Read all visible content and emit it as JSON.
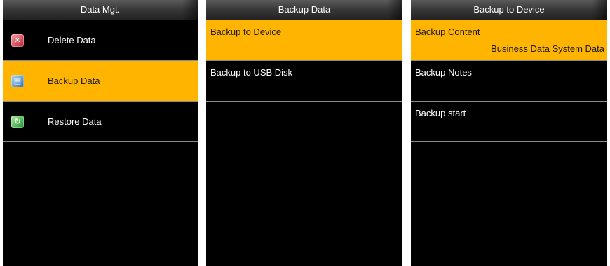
{
  "screen1": {
    "title": "Data Mgt.",
    "items": [
      {
        "label": "Delete Data",
        "icon": "delete-data-icon",
        "selected": false
      },
      {
        "label": "Backup Data",
        "icon": "backup-data-icon",
        "selected": true
      },
      {
        "label": "Restore Data",
        "icon": "restore-data-icon",
        "selected": false
      }
    ]
  },
  "screen2": {
    "title": "Backup Data",
    "items": [
      {
        "label": "Backup to Device",
        "selected": true
      },
      {
        "label": "Backup to USB Disk",
        "selected": false
      }
    ]
  },
  "screen3": {
    "title": "Backup to Device",
    "items": [
      {
        "label": "Backup Content",
        "value": "Business Data System Data",
        "selected": true
      },
      {
        "label": "Backup Notes",
        "value": "",
        "selected": false
      },
      {
        "label": "Backup start",
        "value": "",
        "selected": false
      }
    ]
  },
  "colors": {
    "highlight": "#ffb400",
    "background": "#000000",
    "text": "#ffffff"
  }
}
